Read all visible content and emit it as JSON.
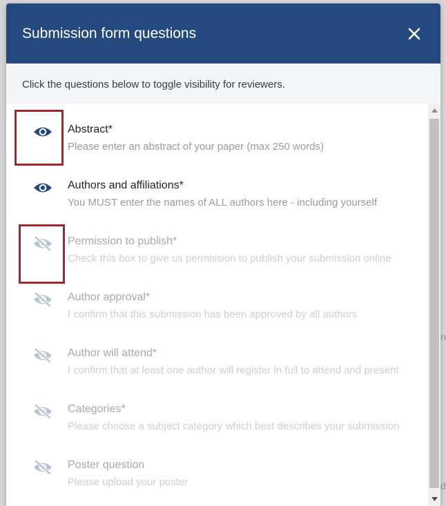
{
  "modal": {
    "title": "Submission form questions",
    "instructions": "Click the questions below to toggle visibility for reviewers."
  },
  "backdrop": {
    "edge_letters": [
      "re",
      "d"
    ]
  },
  "questions": [
    {
      "title": "Abstract*",
      "description": "Please enter an abstract of your paper (max 250 words)",
      "visible": true
    },
    {
      "title": "Authors and affiliations*",
      "description": "You MUST enter the names of ALL authors here - including yourself",
      "visible": true
    },
    {
      "title": "Permission to publish*",
      "description": "Check this box to give us permission to publish your submission online",
      "visible": false
    },
    {
      "title": "Author approval*",
      "description": "I confirm that this submission has been approved by all authors",
      "visible": false
    },
    {
      "title": "Author will attend*",
      "description": "I confirm that at least one author will register in full to attend and present",
      "visible": false
    },
    {
      "title": "Categories*",
      "description": "Please choose a subject category which best describes your submission",
      "visible": false
    },
    {
      "title": "Poster question",
      "description": "Please upload your poster",
      "visible": false
    }
  ],
  "colors": {
    "header_bg": "#24497f",
    "eye_visible": "#24497f",
    "eye_hidden": "#b5c2d3",
    "highlight": "#a3262a"
  },
  "icons": {
    "visible": "eye-icon",
    "hidden": "eye-off-icon",
    "close": "close-icon"
  }
}
